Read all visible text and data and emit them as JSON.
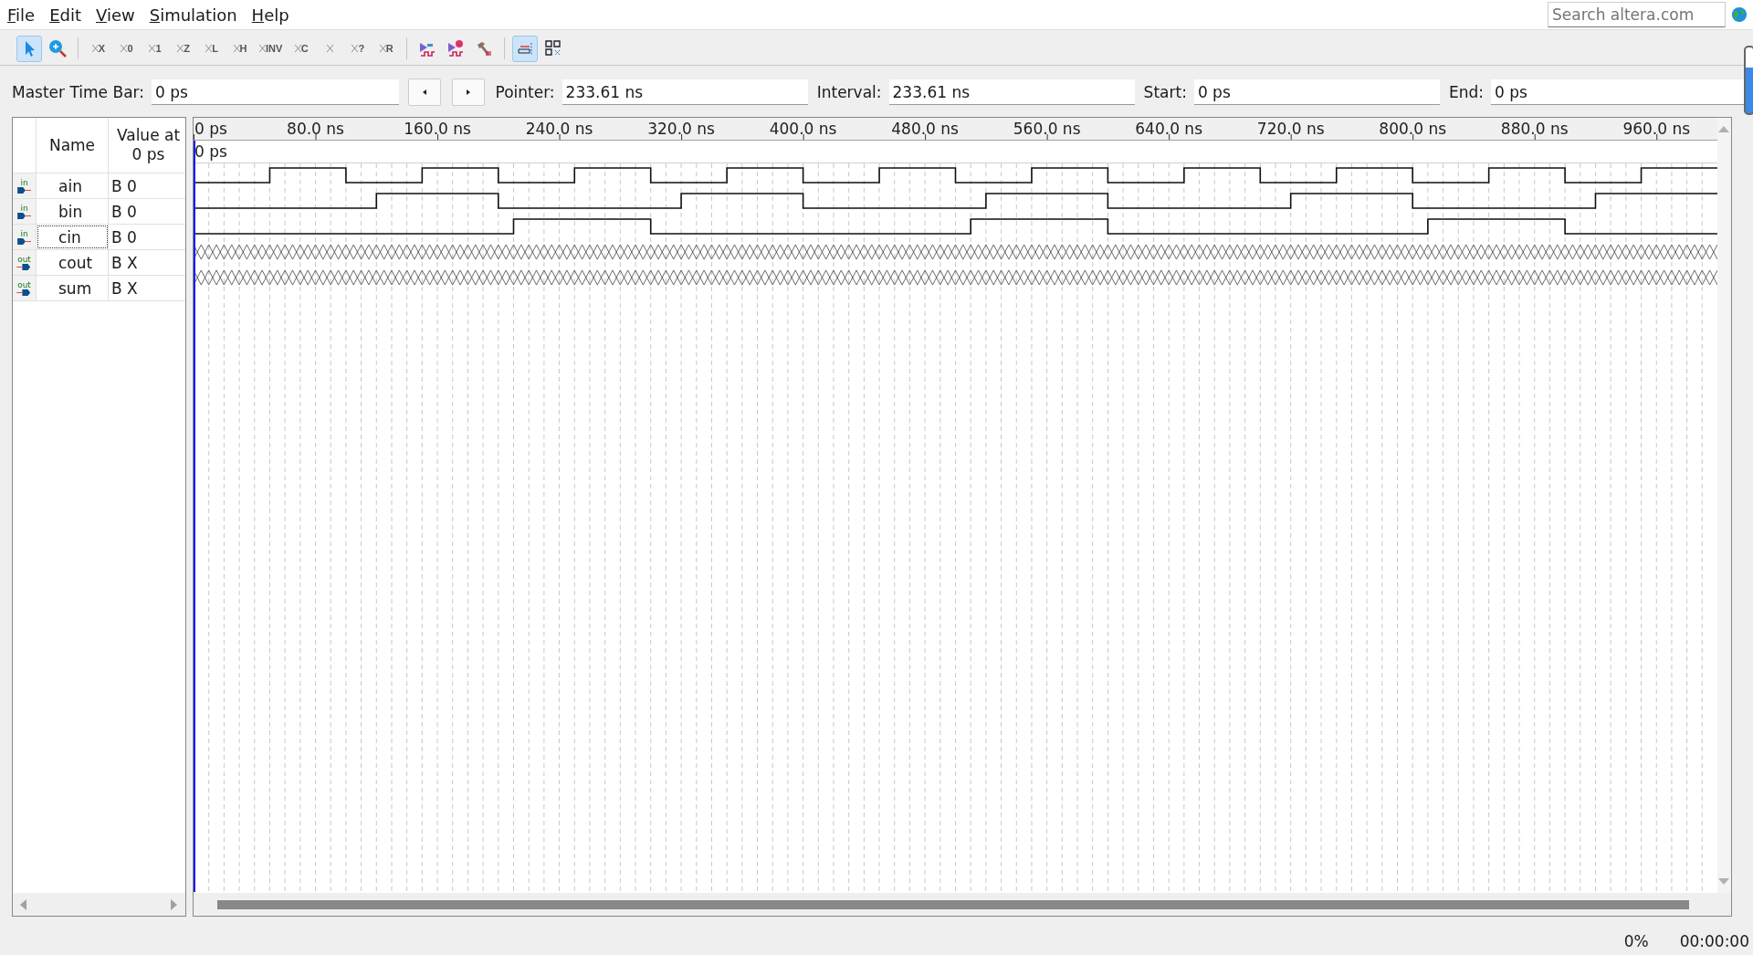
{
  "menu": [
    "File",
    "Edit",
    "View",
    "Simulation",
    "Help"
  ],
  "search": {
    "placeholder": "Search altera.com"
  },
  "toolbar": [
    {
      "kind": "pointer",
      "selected": true
    },
    {
      "kind": "zoom",
      "selected": false
    },
    {
      "kind": "sep"
    },
    {
      "kind": "value",
      "symbol": "X",
      "selected": false
    },
    {
      "kind": "value",
      "symbol": "0",
      "selected": false
    },
    {
      "kind": "value",
      "symbol": "1",
      "selected": false
    },
    {
      "kind": "value",
      "symbol": "Z",
      "selected": false
    },
    {
      "kind": "value",
      "symbol": "L",
      "selected": false
    },
    {
      "kind": "value",
      "symbol": "H",
      "selected": false
    },
    {
      "kind": "value",
      "symbol": "INV",
      "selected": false
    },
    {
      "kind": "value",
      "symbol": "C",
      "selected": false
    },
    {
      "kind": "value",
      "selected": false
    },
    {
      "kind": "value",
      "symbol": "?",
      "selected": false
    },
    {
      "kind": "value",
      "symbol": "R",
      "selected": false
    },
    {
      "kind": "sep"
    },
    {
      "kind": "sim",
      "selected": false
    },
    {
      "kind": "simtime",
      "selected": false
    },
    {
      "kind": "hammer",
      "selected": false
    },
    {
      "kind": "sep"
    },
    {
      "kind": "snap",
      "selected": true
    },
    {
      "kind": "grid",
      "selected": false
    }
  ],
  "time_bar": {
    "master_label": "Master Time Bar:",
    "master": "0 ps",
    "pointer_label": "Pointer:",
    "pointer": "233.61 ns",
    "interval_label": "Interval:",
    "interval": "233.61 ns",
    "start_label": "Start:",
    "start": "0 ps",
    "end_label": "End:",
    "end": "0 ps"
  },
  "name_panel": {
    "columns": [
      "Name",
      "Value at 0 ps"
    ],
    "signals": [
      {
        "direction": "in",
        "name": "ain",
        "value": "B 0",
        "focused": false
      },
      {
        "direction": "in",
        "name": "bin",
        "value": "B 0",
        "focused": false
      },
      {
        "direction": "in",
        "name": "cin",
        "value": "B 0",
        "focused": true
      },
      {
        "direction": "out",
        "name": "cout",
        "value": "B X",
        "focused": false
      },
      {
        "direction": "out",
        "name": "sum",
        "value": "B X",
        "focused": false
      }
    ]
  },
  "waveform": {
    "cursor_label": "0 ps",
    "ruler": [
      "0 ps",
      "80.0 ns",
      "160.0 ns",
      "240.0 ns",
      "320.0 ns",
      "400.0 ns",
      "480.0 ns",
      "560.0 ns",
      "640.0 ns",
      "720.0 ns",
      "800.0 ns",
      "880.0 ns",
      "960.0 ns"
    ]
  },
  "status": {
    "progress": "0%",
    "elapsed": "00:00:00"
  }
}
